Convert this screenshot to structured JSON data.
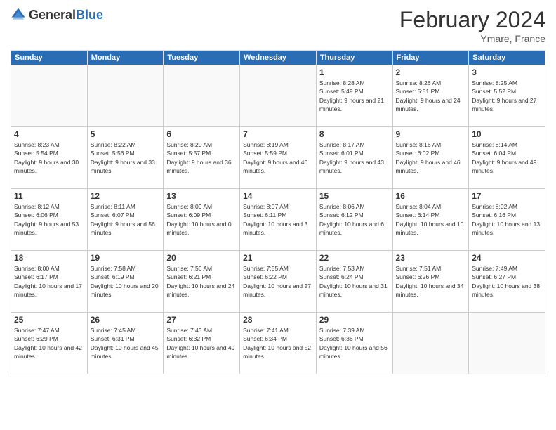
{
  "header": {
    "logo_general": "General",
    "logo_blue": "Blue",
    "month_title": "February 2024",
    "location": "Ymare, France"
  },
  "days_of_week": [
    "Sunday",
    "Monday",
    "Tuesday",
    "Wednesday",
    "Thursday",
    "Friday",
    "Saturday"
  ],
  "weeks": [
    [
      {
        "day": "",
        "info": ""
      },
      {
        "day": "",
        "info": ""
      },
      {
        "day": "",
        "info": ""
      },
      {
        "day": "",
        "info": ""
      },
      {
        "day": "1",
        "info": "Sunrise: 8:28 AM\nSunset: 5:49 PM\nDaylight: 9 hours and 21 minutes."
      },
      {
        "day": "2",
        "info": "Sunrise: 8:26 AM\nSunset: 5:51 PM\nDaylight: 9 hours and 24 minutes."
      },
      {
        "day": "3",
        "info": "Sunrise: 8:25 AM\nSunset: 5:52 PM\nDaylight: 9 hours and 27 minutes."
      }
    ],
    [
      {
        "day": "4",
        "info": "Sunrise: 8:23 AM\nSunset: 5:54 PM\nDaylight: 9 hours and 30 minutes."
      },
      {
        "day": "5",
        "info": "Sunrise: 8:22 AM\nSunset: 5:56 PM\nDaylight: 9 hours and 33 minutes."
      },
      {
        "day": "6",
        "info": "Sunrise: 8:20 AM\nSunset: 5:57 PM\nDaylight: 9 hours and 36 minutes."
      },
      {
        "day": "7",
        "info": "Sunrise: 8:19 AM\nSunset: 5:59 PM\nDaylight: 9 hours and 40 minutes."
      },
      {
        "day": "8",
        "info": "Sunrise: 8:17 AM\nSunset: 6:01 PM\nDaylight: 9 hours and 43 minutes."
      },
      {
        "day": "9",
        "info": "Sunrise: 8:16 AM\nSunset: 6:02 PM\nDaylight: 9 hours and 46 minutes."
      },
      {
        "day": "10",
        "info": "Sunrise: 8:14 AM\nSunset: 6:04 PM\nDaylight: 9 hours and 49 minutes."
      }
    ],
    [
      {
        "day": "11",
        "info": "Sunrise: 8:12 AM\nSunset: 6:06 PM\nDaylight: 9 hours and 53 minutes."
      },
      {
        "day": "12",
        "info": "Sunrise: 8:11 AM\nSunset: 6:07 PM\nDaylight: 9 hours and 56 minutes."
      },
      {
        "day": "13",
        "info": "Sunrise: 8:09 AM\nSunset: 6:09 PM\nDaylight: 10 hours and 0 minutes."
      },
      {
        "day": "14",
        "info": "Sunrise: 8:07 AM\nSunset: 6:11 PM\nDaylight: 10 hours and 3 minutes."
      },
      {
        "day": "15",
        "info": "Sunrise: 8:06 AM\nSunset: 6:12 PM\nDaylight: 10 hours and 6 minutes."
      },
      {
        "day": "16",
        "info": "Sunrise: 8:04 AM\nSunset: 6:14 PM\nDaylight: 10 hours and 10 minutes."
      },
      {
        "day": "17",
        "info": "Sunrise: 8:02 AM\nSunset: 6:16 PM\nDaylight: 10 hours and 13 minutes."
      }
    ],
    [
      {
        "day": "18",
        "info": "Sunrise: 8:00 AM\nSunset: 6:17 PM\nDaylight: 10 hours and 17 minutes."
      },
      {
        "day": "19",
        "info": "Sunrise: 7:58 AM\nSunset: 6:19 PM\nDaylight: 10 hours and 20 minutes."
      },
      {
        "day": "20",
        "info": "Sunrise: 7:56 AM\nSunset: 6:21 PM\nDaylight: 10 hours and 24 minutes."
      },
      {
        "day": "21",
        "info": "Sunrise: 7:55 AM\nSunset: 6:22 PM\nDaylight: 10 hours and 27 minutes."
      },
      {
        "day": "22",
        "info": "Sunrise: 7:53 AM\nSunset: 6:24 PM\nDaylight: 10 hours and 31 minutes."
      },
      {
        "day": "23",
        "info": "Sunrise: 7:51 AM\nSunset: 6:26 PM\nDaylight: 10 hours and 34 minutes."
      },
      {
        "day": "24",
        "info": "Sunrise: 7:49 AM\nSunset: 6:27 PM\nDaylight: 10 hours and 38 minutes."
      }
    ],
    [
      {
        "day": "25",
        "info": "Sunrise: 7:47 AM\nSunset: 6:29 PM\nDaylight: 10 hours and 42 minutes."
      },
      {
        "day": "26",
        "info": "Sunrise: 7:45 AM\nSunset: 6:31 PM\nDaylight: 10 hours and 45 minutes."
      },
      {
        "day": "27",
        "info": "Sunrise: 7:43 AM\nSunset: 6:32 PM\nDaylight: 10 hours and 49 minutes."
      },
      {
        "day": "28",
        "info": "Sunrise: 7:41 AM\nSunset: 6:34 PM\nDaylight: 10 hours and 52 minutes."
      },
      {
        "day": "29",
        "info": "Sunrise: 7:39 AM\nSunset: 6:36 PM\nDaylight: 10 hours and 56 minutes."
      },
      {
        "day": "",
        "info": ""
      },
      {
        "day": "",
        "info": ""
      }
    ]
  ]
}
